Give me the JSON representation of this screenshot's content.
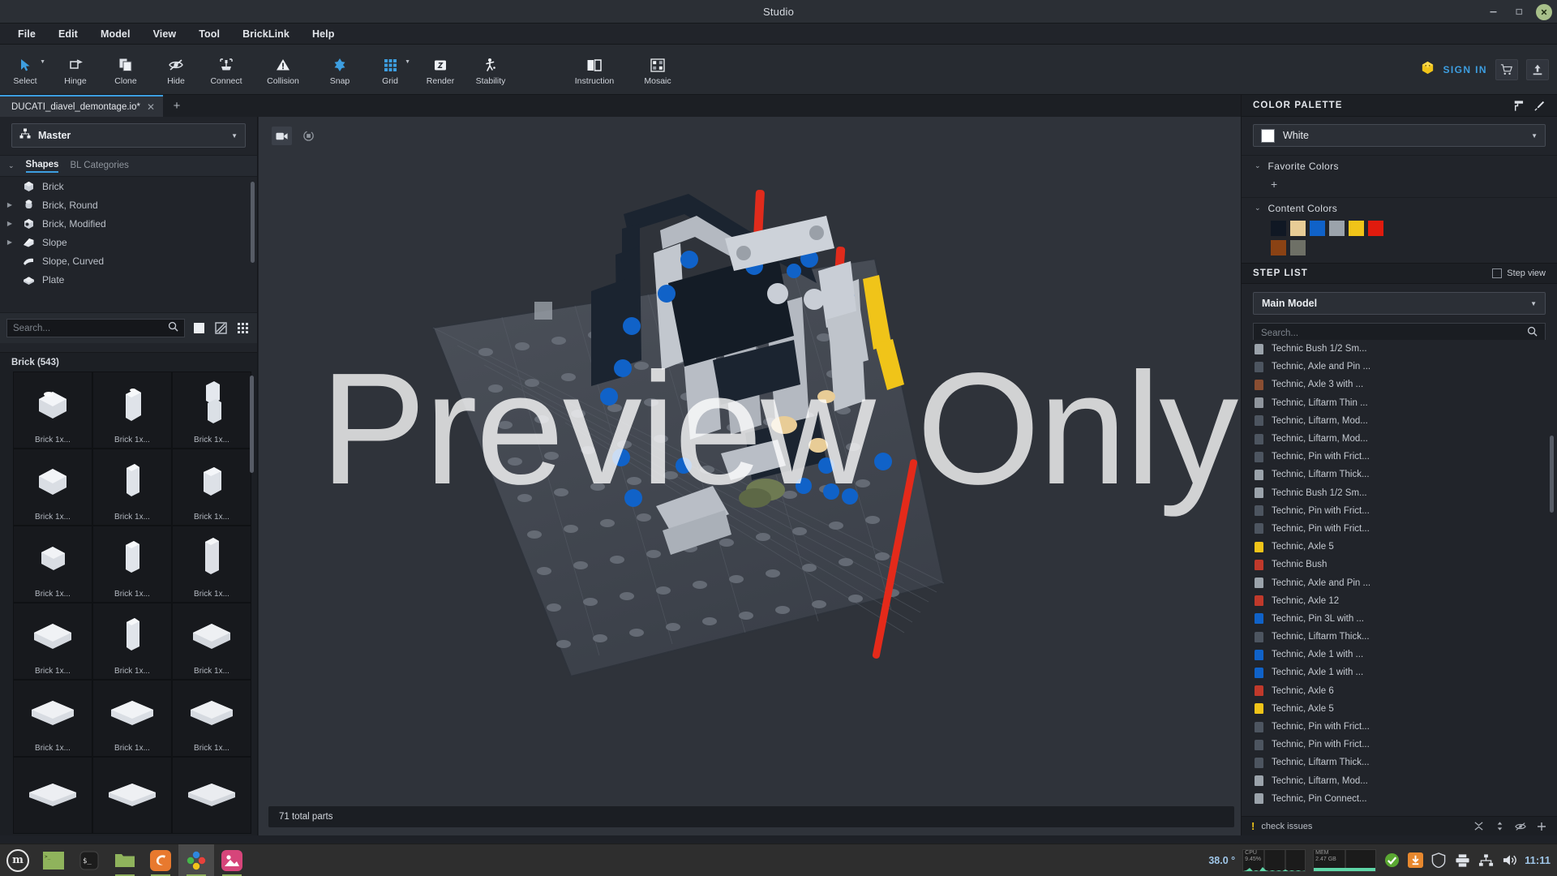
{
  "window": {
    "title": "Studio",
    "minimize": "−",
    "maximize": "❐",
    "close": "✕"
  },
  "menubar": {
    "items": [
      "File",
      "Edit",
      "Model",
      "View",
      "Tool",
      "BrickLink",
      "Help"
    ]
  },
  "toolbar": {
    "tools": [
      {
        "label": "Select",
        "icon": "cursor-icon",
        "caret": true
      },
      {
        "label": "Hinge",
        "icon": "hinge-icon",
        "caret": false
      },
      {
        "label": "Clone",
        "icon": "clone-icon",
        "caret": false
      },
      {
        "label": "Hide",
        "icon": "eye-off-icon",
        "caret": false
      },
      {
        "label": "Connect",
        "icon": "connect-icon",
        "caret": false
      },
      {
        "label": "Collision",
        "icon": "collision-icon",
        "caret": false
      },
      {
        "label": "Snap",
        "icon": "snap-icon",
        "caret": false
      },
      {
        "label": "Grid",
        "icon": "grid-icon",
        "caret": true
      },
      {
        "label": "Render",
        "icon": "render-camera-icon",
        "caret": false
      },
      {
        "label": "Stability",
        "icon": "stability-icon",
        "caret": false
      },
      {
        "label": "Instruction",
        "icon": "instruction-book-icon",
        "caret": false
      },
      {
        "label": "Mosaic",
        "icon": "mosaic-icon",
        "caret": false
      }
    ],
    "sign_in": "SIGN IN",
    "cart_icon": "shopping-cart-icon",
    "upload_icon": "upload-icon",
    "accent_blue": "#3d9ee0"
  },
  "tabs": {
    "open": [
      {
        "label": "DUCATI_diavel_demontage.io*",
        "close": "✕"
      }
    ],
    "add": "+",
    "prev": "◀",
    "next": "▶"
  },
  "left_panel": {
    "master_selector": {
      "label": "Master",
      "icon": "model-tree-icon",
      "caret": "▼"
    },
    "category_tabs": [
      {
        "label": "Shapes",
        "active": true
      },
      {
        "label": "BL Categories",
        "active": false
      }
    ],
    "shapes": [
      {
        "label": "Brick",
        "expandable": false
      },
      {
        "label": "Brick, Round",
        "expandable": true
      },
      {
        "label": "Brick, Modified",
        "expandable": true
      },
      {
        "label": "Slope",
        "expandable": true
      },
      {
        "label": "Slope, Curved",
        "expandable": false
      },
      {
        "label": "Plate",
        "expandable": false
      }
    ],
    "search": {
      "placeholder": "Search...",
      "value": "",
      "icon": "search-icon"
    },
    "view_buttons": [
      "solid-view-icon",
      "pattern-view-icon",
      "grid-view-icon"
    ],
    "parts_group_header": "Brick (543)",
    "parts": [
      {
        "caption": "Brick 1x..."
      },
      {
        "caption": "Brick 1x..."
      },
      {
        "caption": "Brick 1x..."
      },
      {
        "caption": "Brick 1x..."
      },
      {
        "caption": "Brick 1x..."
      },
      {
        "caption": "Brick 1x..."
      },
      {
        "caption": "Brick 1x..."
      },
      {
        "caption": "Brick 1x..."
      },
      {
        "caption": "Brick 1x..."
      },
      {
        "caption": "Brick 1x..."
      },
      {
        "caption": "Brick 1x..."
      },
      {
        "caption": "Brick 1x..."
      },
      {
        "caption": "Brick 1x..."
      },
      {
        "caption": "Brick 1x..."
      },
      {
        "caption": "Brick 1x..."
      },
      {
        "caption": ""
      },
      {
        "caption": ""
      },
      {
        "caption": ""
      }
    ]
  },
  "viewport": {
    "tools": [
      {
        "icon": "camera-icon",
        "selected": true
      },
      {
        "icon": "rotate-view-icon",
        "selected": false
      }
    ],
    "status": "71 total parts"
  },
  "right_panel": {
    "color_palette": {
      "title": "COLOR PALETTE",
      "paint_icon": "paint-roller-icon",
      "picker_icon": "eyedropper-icon",
      "selected_color": {
        "name": "White",
        "hex": "#ffffff",
        "caret": "▼"
      },
      "favorite_colors": {
        "title": "Favorite Colors",
        "chevron": "⌄",
        "add": "+"
      },
      "content_colors": {
        "title": "Content Colors",
        "chevron": "⌄",
        "swatches": [
          "#101824",
          "#e8cc96",
          "#1062c8",
          "#9ba3ab",
          "#f0c419",
          "#e01b0e",
          "#8a4214",
          "#6e7066"
        ]
      }
    },
    "step_list": {
      "title": "STEP LIST",
      "step_view_label": "Step view",
      "step_view_checked": false,
      "model_selector": {
        "label": "Main Model",
        "caret": "▼"
      },
      "search": {
        "placeholder": "Search...",
        "value": "",
        "icon": "search-icon"
      },
      "parts": [
        {
          "name": "Technic Bush 1/2 Sm...",
          "color": "#9ba3ab"
        },
        {
          "name": "Technic, Axle and Pin ...",
          "color": "#4d5560"
        },
        {
          "name": "Technic, Axle 3 with ...",
          "color": "#8a4e32"
        },
        {
          "name": "Technic, Liftarm Thin ...",
          "color": "#8f959d"
        },
        {
          "name": "Technic, Liftarm, Mod...",
          "color": "#4d5560"
        },
        {
          "name": "Technic, Liftarm, Mod...",
          "color": "#4d5560"
        },
        {
          "name": "Technic, Pin with Frict...",
          "color": "#4d5560"
        },
        {
          "name": "Technic, Liftarm Thick...",
          "color": "#9ba3ab"
        },
        {
          "name": "Technic Bush 1/2 Sm...",
          "color": "#9ba3ab"
        },
        {
          "name": "Technic, Pin with Frict...",
          "color": "#4d5560"
        },
        {
          "name": "Technic, Pin with Frict...",
          "color": "#4d5560"
        },
        {
          "name": "Technic, Axle 5",
          "color": "#f0c419"
        },
        {
          "name": "Technic Bush",
          "color": "#c0392b"
        },
        {
          "name": "Technic, Axle and Pin ...",
          "color": "#9ba3ab"
        },
        {
          "name": "Technic, Axle 12",
          "color": "#c0392b"
        },
        {
          "name": "Technic, Pin 3L with ...",
          "color": "#1062c8"
        },
        {
          "name": "Technic, Liftarm Thick...",
          "color": "#4d5560"
        },
        {
          "name": "Technic, Axle 1 with ...",
          "color": "#1062c8"
        },
        {
          "name": "Technic, Axle 1 with ...",
          "color": "#1062c8"
        },
        {
          "name": "Technic, Axle 6",
          "color": "#c0392b"
        },
        {
          "name": "Technic, Axle 5",
          "color": "#f0c419"
        },
        {
          "name": "Technic, Pin with Frict...",
          "color": "#4d5560"
        },
        {
          "name": "Technic, Pin with Frict...",
          "color": "#4d5560"
        },
        {
          "name": "Technic, Liftarm Thick...",
          "color": "#4d5560"
        },
        {
          "name": "Technic, Liftarm, Mod...",
          "color": "#9ba3ab"
        },
        {
          "name": "Technic, Pin Connect...",
          "color": "#9ba3ab"
        }
      ]
    },
    "issues_bar": {
      "warn_icon": "warning-icon",
      "label": "check issues",
      "icons": [
        "collapse-icon",
        "sort-icon",
        "hide-icon",
        "add-icon"
      ]
    }
  },
  "taskbar": {
    "menu_icon": "linux-mint-menu-icon",
    "apps": [
      {
        "icon": "terminal-green-icon",
        "running": false
      },
      {
        "icon": "terminal-black-icon",
        "running": false
      },
      {
        "icon": "file-manager-icon",
        "running": true
      },
      {
        "icon": "firefox-icon",
        "running": true
      },
      {
        "icon": "studio-icon",
        "running": true,
        "active": true
      },
      {
        "icon": "image-viewer-icon",
        "running": true
      }
    ],
    "temperature": "38.0 °",
    "cpu_graph": {
      "label": "CPU",
      "value": "9.45%"
    },
    "mem_graph": {
      "label": "MEM",
      "value": "2.47 GB"
    },
    "tray": [
      "update-ok-icon",
      "update-pending-icon",
      "firewall-shield-icon",
      "printer-icon",
      "network-icon",
      "volume-icon"
    ],
    "clock": "11:11"
  },
  "overlay": {
    "watermark": "Preview Only"
  }
}
